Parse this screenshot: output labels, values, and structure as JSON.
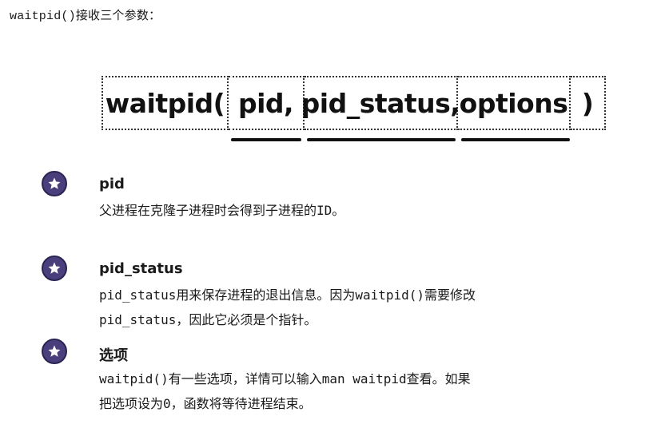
{
  "intro": "waitpid()接收三个参数：",
  "signature": {
    "function": "waitpid(",
    "param1": "pid,",
    "param2": "pid_status,",
    "param3": "options",
    "close": ")"
  },
  "params": [
    {
      "icon": "star-icon",
      "title": "pid",
      "lines": [
        "父进程在克隆子进程时会得到子进程的ID。"
      ]
    },
    {
      "icon": "star-icon",
      "title": "pid_status",
      "lines": [
        "pid_status用来保存进程的退出信息。因为waitpid()需要修改",
        "pid_status，因此它必须是个指针。"
      ]
    },
    {
      "icon": "star-icon",
      "title": "选项",
      "lines": [
        "waitpid()有一些选项，详情可以输入man   waitpid查看。如果",
        "把选项设为0，函数将等待进程结束。"
      ]
    }
  ],
  "colors": {
    "bullet_fill": "#4a3f7c",
    "text": "#1a1a1a"
  }
}
